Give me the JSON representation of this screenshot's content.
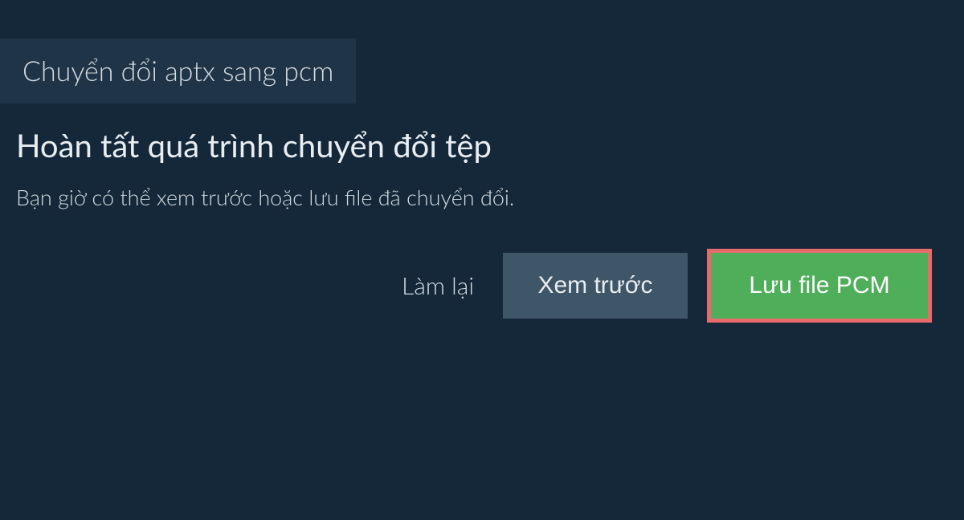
{
  "tab": {
    "label": "Chuyển đổi aptx sang pcm"
  },
  "main": {
    "title": "Hoàn tất quá trình chuyển đổi tệp",
    "subtitle": "Bạn giờ có thể xem trước hoặc lưu file đã chuyển đổi."
  },
  "buttons": {
    "retry": "Làm lại",
    "preview": "Xem trước",
    "save": "Lưu file PCM"
  }
}
